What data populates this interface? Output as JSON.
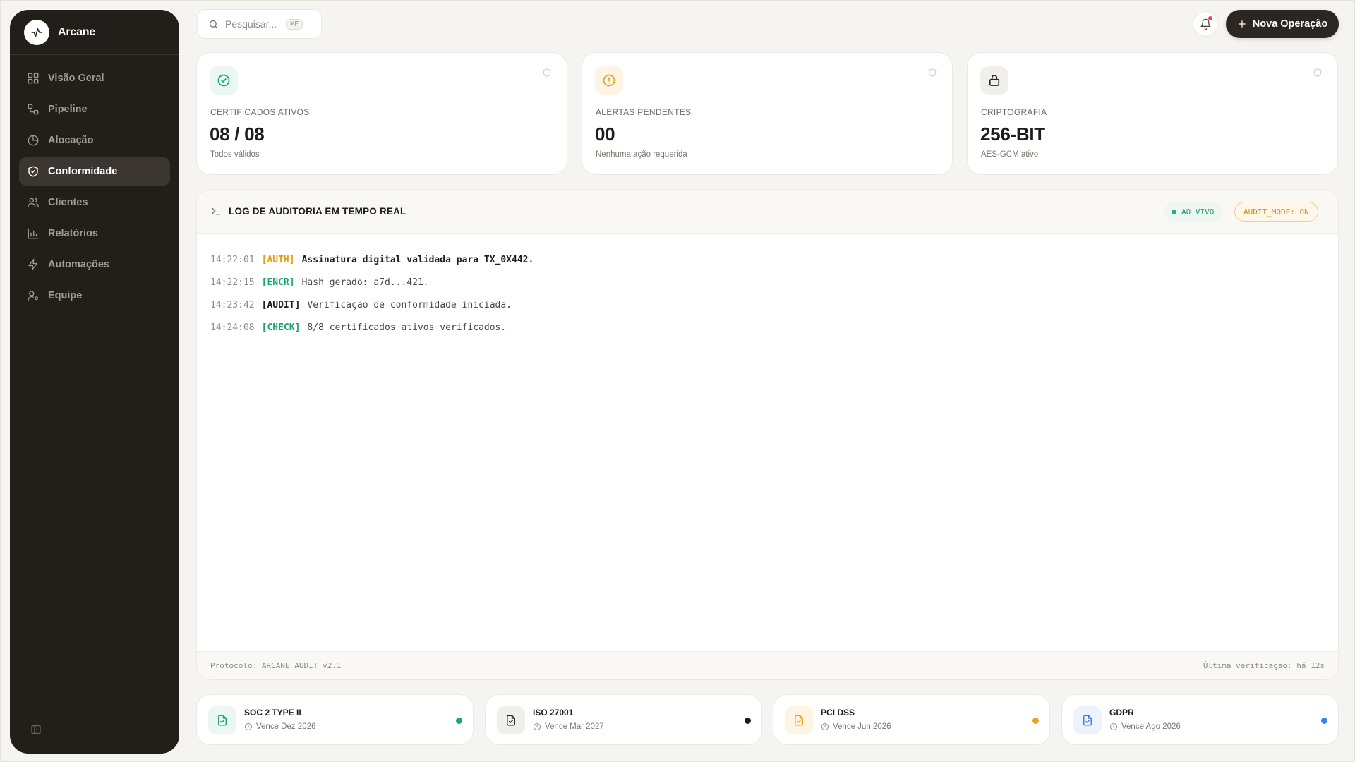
{
  "app": {
    "name": "Arcane"
  },
  "sidebar": {
    "items": [
      {
        "label": "Visão Geral",
        "icon": "grid-icon",
        "active": false
      },
      {
        "label": "Pipeline",
        "icon": "workflow-icon",
        "active": false
      },
      {
        "label": "Alocação",
        "icon": "pie-chart-icon",
        "active": false
      },
      {
        "label": "Conformidade",
        "icon": "shield-check-icon",
        "active": true
      },
      {
        "label": "Clientes",
        "icon": "users-icon",
        "active": false
      },
      {
        "label": "Relatórios",
        "icon": "bar-chart-icon",
        "active": false
      },
      {
        "label": "Automações",
        "icon": "bolt-icon",
        "active": false
      },
      {
        "label": "Equipe",
        "icon": "user-gear-icon",
        "active": false
      }
    ]
  },
  "topbar": {
    "search_placeholder": "Pesquisar...",
    "search_shortcut": "⌘F",
    "new_operation_label": "Nova Operação"
  },
  "stats": [
    {
      "label": "CERTIFICADOS ATIVOS",
      "value": "08 / 08",
      "sub": "Todos válidos",
      "icon": "check-circle-icon",
      "color": "#1aa571",
      "bg": "#ecf7f1"
    },
    {
      "label": "ALERTAS PENDENTES",
      "value": "00",
      "sub": "Nenhuma ação requerida",
      "icon": "alert-circle-icon",
      "color": "#e5a01a",
      "bg": "#fdf4e3"
    },
    {
      "label": "CRIPTOGRAFIA",
      "value": "256-BIT",
      "sub": "AES-GCM ativo",
      "icon": "lock-icon",
      "color": "#2b2622",
      "bg": "#f1efeb"
    }
  ],
  "audit": {
    "title": "LOG DE AUDITORIA EM TEMPO REAL",
    "live_label": "AO VIVO",
    "mode_label": "AUDIT_MODE: ON",
    "entries": [
      {
        "time": "14:22:01",
        "tag": "[AUTH]",
        "tag_color": "#e5a01a",
        "message": "Assinatura digital validada para TX_0X442."
      },
      {
        "time": "14:22:15",
        "tag": "[ENCR]",
        "tag_color": "#1aa571",
        "message": "Hash gerado: a7d...421."
      },
      {
        "time": "14:23:42",
        "tag": "[AUDIT]",
        "tag_color": "#1f1c19",
        "message": "Verificação de conformidade iniciada."
      },
      {
        "time": "14:24:08",
        "tag": "[CHECK]",
        "tag_color": "#1aa571",
        "message": "8/8 certificados ativos verificados."
      }
    ],
    "footer_left": "Protocolo: ARCANE_AUDIT_v2.1",
    "footer_right": "Última verificação: há 12s"
  },
  "certs": [
    {
      "name": "SOC 2 TYPE II",
      "expires": "Vence Dez 2026",
      "color": "#1aa571",
      "bg": "#ecf7f1",
      "dot": "#1aa571"
    },
    {
      "name": "ISO 27001",
      "expires": "Vence Mar 2027",
      "color": "#2b2622",
      "bg": "#f1efeb",
      "dot": "#1f1c19"
    },
    {
      "name": "PCI DSS",
      "expires": "Vence Jun 2026",
      "color": "#e5a01a",
      "bg": "#fdf4e3",
      "dot": "#f0a020"
    },
    {
      "name": "GDPR",
      "expires": "Vence Ago 2026",
      "color": "#3b7be8",
      "bg": "#edf3fd",
      "dot": "#3b82f6"
    }
  ]
}
